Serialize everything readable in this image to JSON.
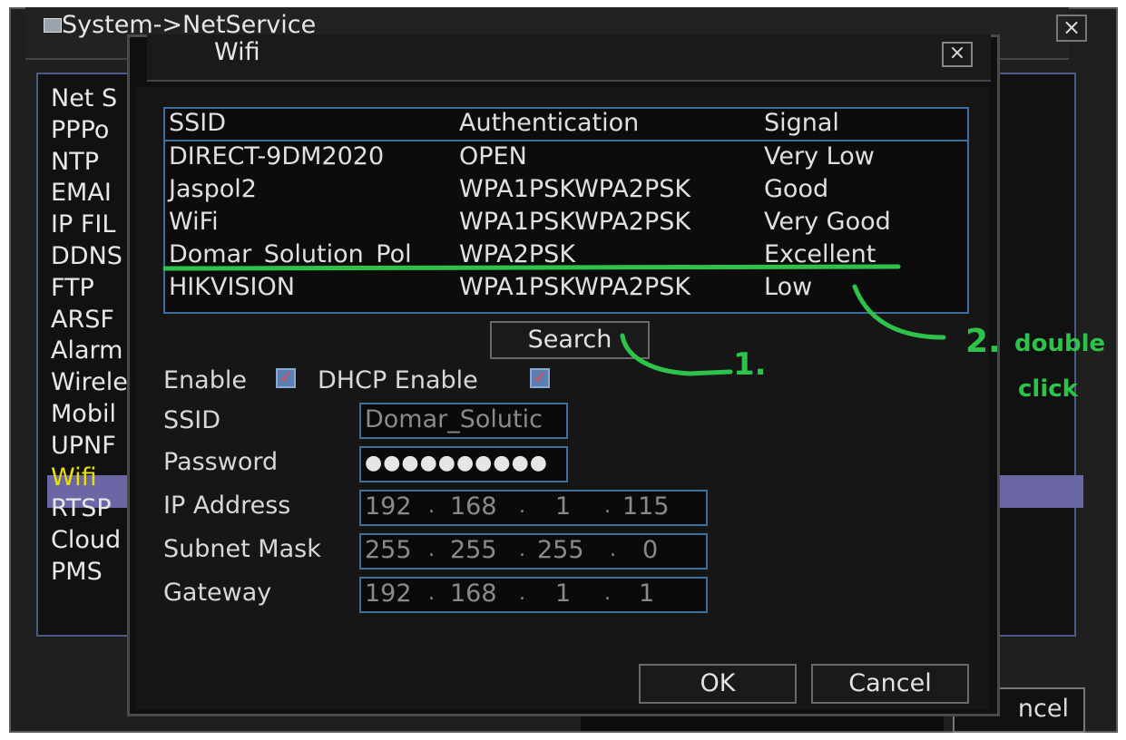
{
  "background_window": {
    "title": "System->NetService",
    "close_label": "×",
    "list_header": "Net S",
    "items": [
      "PPPo",
      "NTP",
      "EMAI",
      "IP FIL",
      "DDNS",
      "FTP",
      "ARSF",
      "Alarm",
      "Wirele",
      "Mobil",
      "UPNF",
      "Wifi",
      "RTSP",
      "Cloud",
      "PMS"
    ],
    "selected_item": "Wifi",
    "cancel_label": "ncel"
  },
  "wifi_dialog": {
    "title": "Wifi",
    "close_label": "×",
    "table": {
      "headers": [
        "SSID",
        "Authentication",
        "Signal"
      ],
      "rows": [
        [
          "DIRECT-9DM2020",
          "OPEN",
          "Very Low"
        ],
        [
          "Jaspol2",
          "WPA1PSKWPA2PSK",
          "Good"
        ],
        [
          "WiFi",
          "WPA1PSKWPA2PSK",
          "Very Good"
        ],
        [
          "Domar_Solution_Pol",
          "WPA2PSK",
          "Excellent"
        ],
        [
          "HIKVISION",
          "WPA1PSKWPA2PSK",
          "Low"
        ]
      ]
    },
    "search_label": "Search",
    "enable_label": "Enable",
    "enable_checked": true,
    "dhcp_label": "DHCP Enable",
    "dhcp_checked": true,
    "ssid_label": "SSID",
    "ssid_value": "Domar_Solutic",
    "password_label": "Password",
    "password_value": "●●●●●●●●●●",
    "ip_label": "IP Address",
    "ip_value": [
      "192",
      "168",
      "1",
      "115"
    ],
    "subnet_label": "Subnet Mask",
    "subnet_value": [
      "255",
      "255",
      "255",
      "0"
    ],
    "gateway_label": "Gateway",
    "gateway_value": [
      "192",
      "168",
      "1",
      "1"
    ],
    "ok_label": "OK",
    "cancel_label": "Cancel"
  },
  "annotations": {
    "step1": "1.",
    "step2_number": "2.",
    "step2_line1": "double",
    "step2_line2": "click",
    "color": "#2fc24a"
  }
}
